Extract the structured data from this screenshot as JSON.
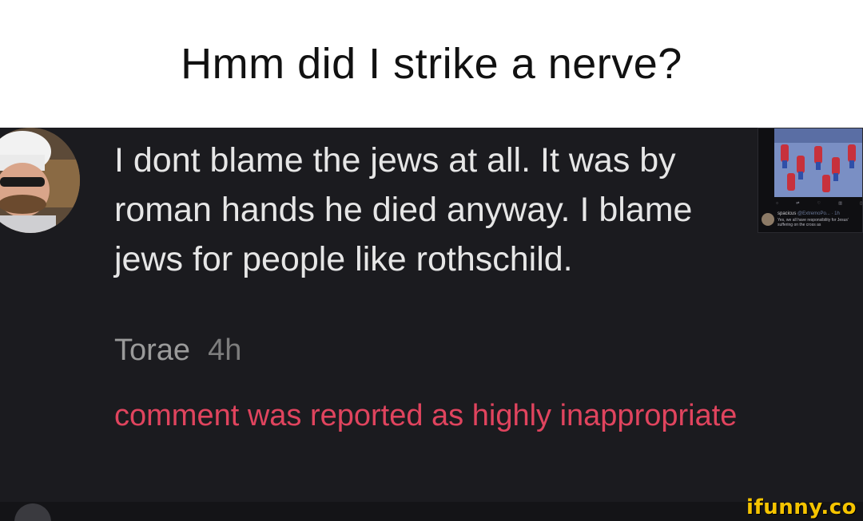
{
  "caption": {
    "text": "Hmm did I strike a nerve?"
  },
  "comment": {
    "avatar_icon": "chef-avatar-icon",
    "text": "I dont blame the jews at all. It was by roman hands he died anyway. I blame jews for people like rothschild.",
    "author": "Torae",
    "time": "4h",
    "report_notice": "comment was reported as highly inappropriate"
  },
  "attached_post": {
    "user": "spacicus",
    "handle": "@ExtremoPo... · 1h",
    "text": "Yes, we all have responsibility for Jesus' suffering on the cross as",
    "image_icon": "spiderman-meme-image"
  },
  "watermark": {
    "text": "ifunny.co"
  },
  "colors": {
    "caption_bg": "#ffffff",
    "screen_bg": "#1b1b1f",
    "comment_text": "#e6e6e6",
    "meta_text": "#9a9a9a",
    "report_text": "#e0445e",
    "watermark": "#f5c400"
  }
}
